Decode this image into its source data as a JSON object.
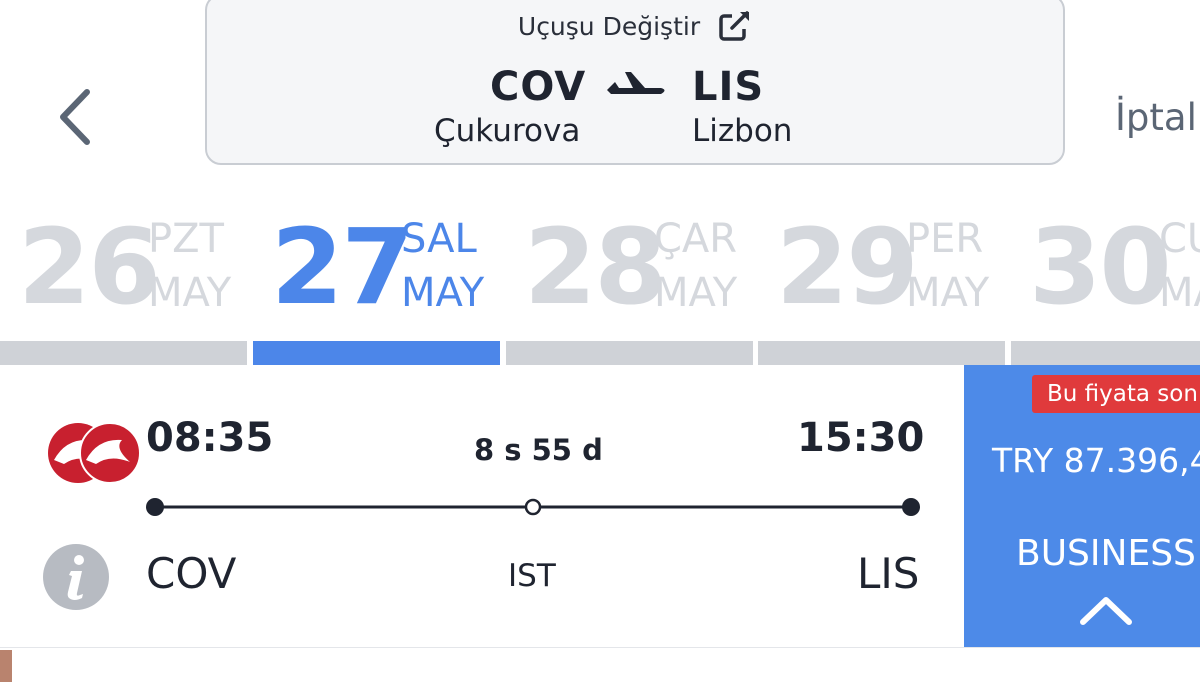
{
  "header": {
    "change_label": "Uçuşu Değiştir",
    "origin": {
      "code": "COV",
      "city": "Çukurova"
    },
    "destination": {
      "code": "LIS",
      "city": "Lizbon"
    },
    "cancel_label": "İptal"
  },
  "dates": [
    {
      "day": "26",
      "dow": "PZT",
      "month": "MAY",
      "selected": false
    },
    {
      "day": "27",
      "dow": "SAL",
      "month": "MAY",
      "selected": true
    },
    {
      "day": "28",
      "dow": "ÇAR",
      "month": "MAY",
      "selected": false
    },
    {
      "day": "29",
      "dow": "PER",
      "month": "MAY",
      "selected": false
    },
    {
      "day": "30",
      "dow": "CU",
      "month": "MA",
      "selected": false
    }
  ],
  "flight": {
    "departure_time": "08:35",
    "arrival_time": "15:30",
    "duration": "8 s 55 d",
    "from": "COV",
    "stop": "IST",
    "to": "LIS",
    "fare": {
      "badge": "Bu fiyata son",
      "price": "TRY 87.396,4",
      "class": "BUSINESS"
    }
  },
  "colors": {
    "accent": "#4c86e9",
    "fare_panel": "#4d8ae8",
    "badge": "#e03a3c",
    "inactive_date": "#d5d8dd",
    "airline_red": "#c8202f"
  }
}
